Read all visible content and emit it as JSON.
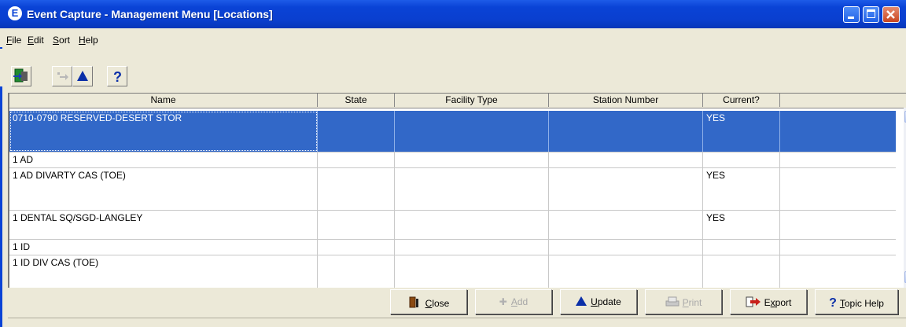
{
  "window": {
    "title": "Event Capture - Management Menu [Locations]",
    "app_icon_glyph": "E"
  },
  "menu": [
    {
      "label": "File"
    },
    {
      "label": "Edit"
    },
    {
      "label": "Sort"
    },
    {
      "label": "Help"
    }
  ],
  "toolbar": {
    "buttons": [
      {
        "icon": "exit-icon"
      },
      {
        "icon": "add-icon",
        "enabled": false
      },
      {
        "icon": "update-triangle-icon"
      },
      {
        "icon": "help-question-icon"
      }
    ]
  },
  "table": {
    "columns": [
      "Name",
      "State",
      "Facility Type",
      "Station Number",
      "Current?"
    ],
    "rows": [
      {
        "name": "0710-0790 RESERVED-DESERT STOR",
        "state": "",
        "facility_type": "",
        "station_number": "",
        "current": "YES",
        "selected": true
      },
      {
        "name": "1 AD",
        "state": "",
        "facility_type": "",
        "station_number": "",
        "current": "",
        "selected": false
      },
      {
        "name": "1 AD DIVARTY CAS (TOE)",
        "state": "",
        "facility_type": "",
        "station_number": "",
        "current": "YES",
        "selected": false
      },
      {
        "name": "1 DENTAL SQ/SGD-LANGLEY",
        "state": "",
        "facility_type": "",
        "station_number": "",
        "current": "YES",
        "selected": false
      },
      {
        "name": "1 ID",
        "state": "",
        "facility_type": "",
        "station_number": "",
        "current": "",
        "selected": false
      },
      {
        "name": "1 ID DIV CAS (TOE)",
        "state": "",
        "facility_type": "",
        "station_number": "",
        "current": "",
        "selected": false
      }
    ]
  },
  "buttons": {
    "close": {
      "label_u": "C",
      "label_rest": "lose",
      "enabled": true
    },
    "add": {
      "label_u": "A",
      "label_rest": "dd",
      "enabled": false
    },
    "update": {
      "label_u": "U",
      "label_rest": "pdate",
      "enabled": true
    },
    "print": {
      "label_u": "P",
      "label_rest": "rint",
      "enabled": false
    },
    "export": {
      "label_pre": "E",
      "label_u": "x",
      "label_rest": "port",
      "enabled": true
    },
    "topic_help": {
      "label_u": "T",
      "label_rest": "opic Help",
      "enabled": true
    }
  },
  "colors": {
    "titlebar": "#0a43d6",
    "selection": "#3268c8",
    "face": "#ece9d8"
  }
}
